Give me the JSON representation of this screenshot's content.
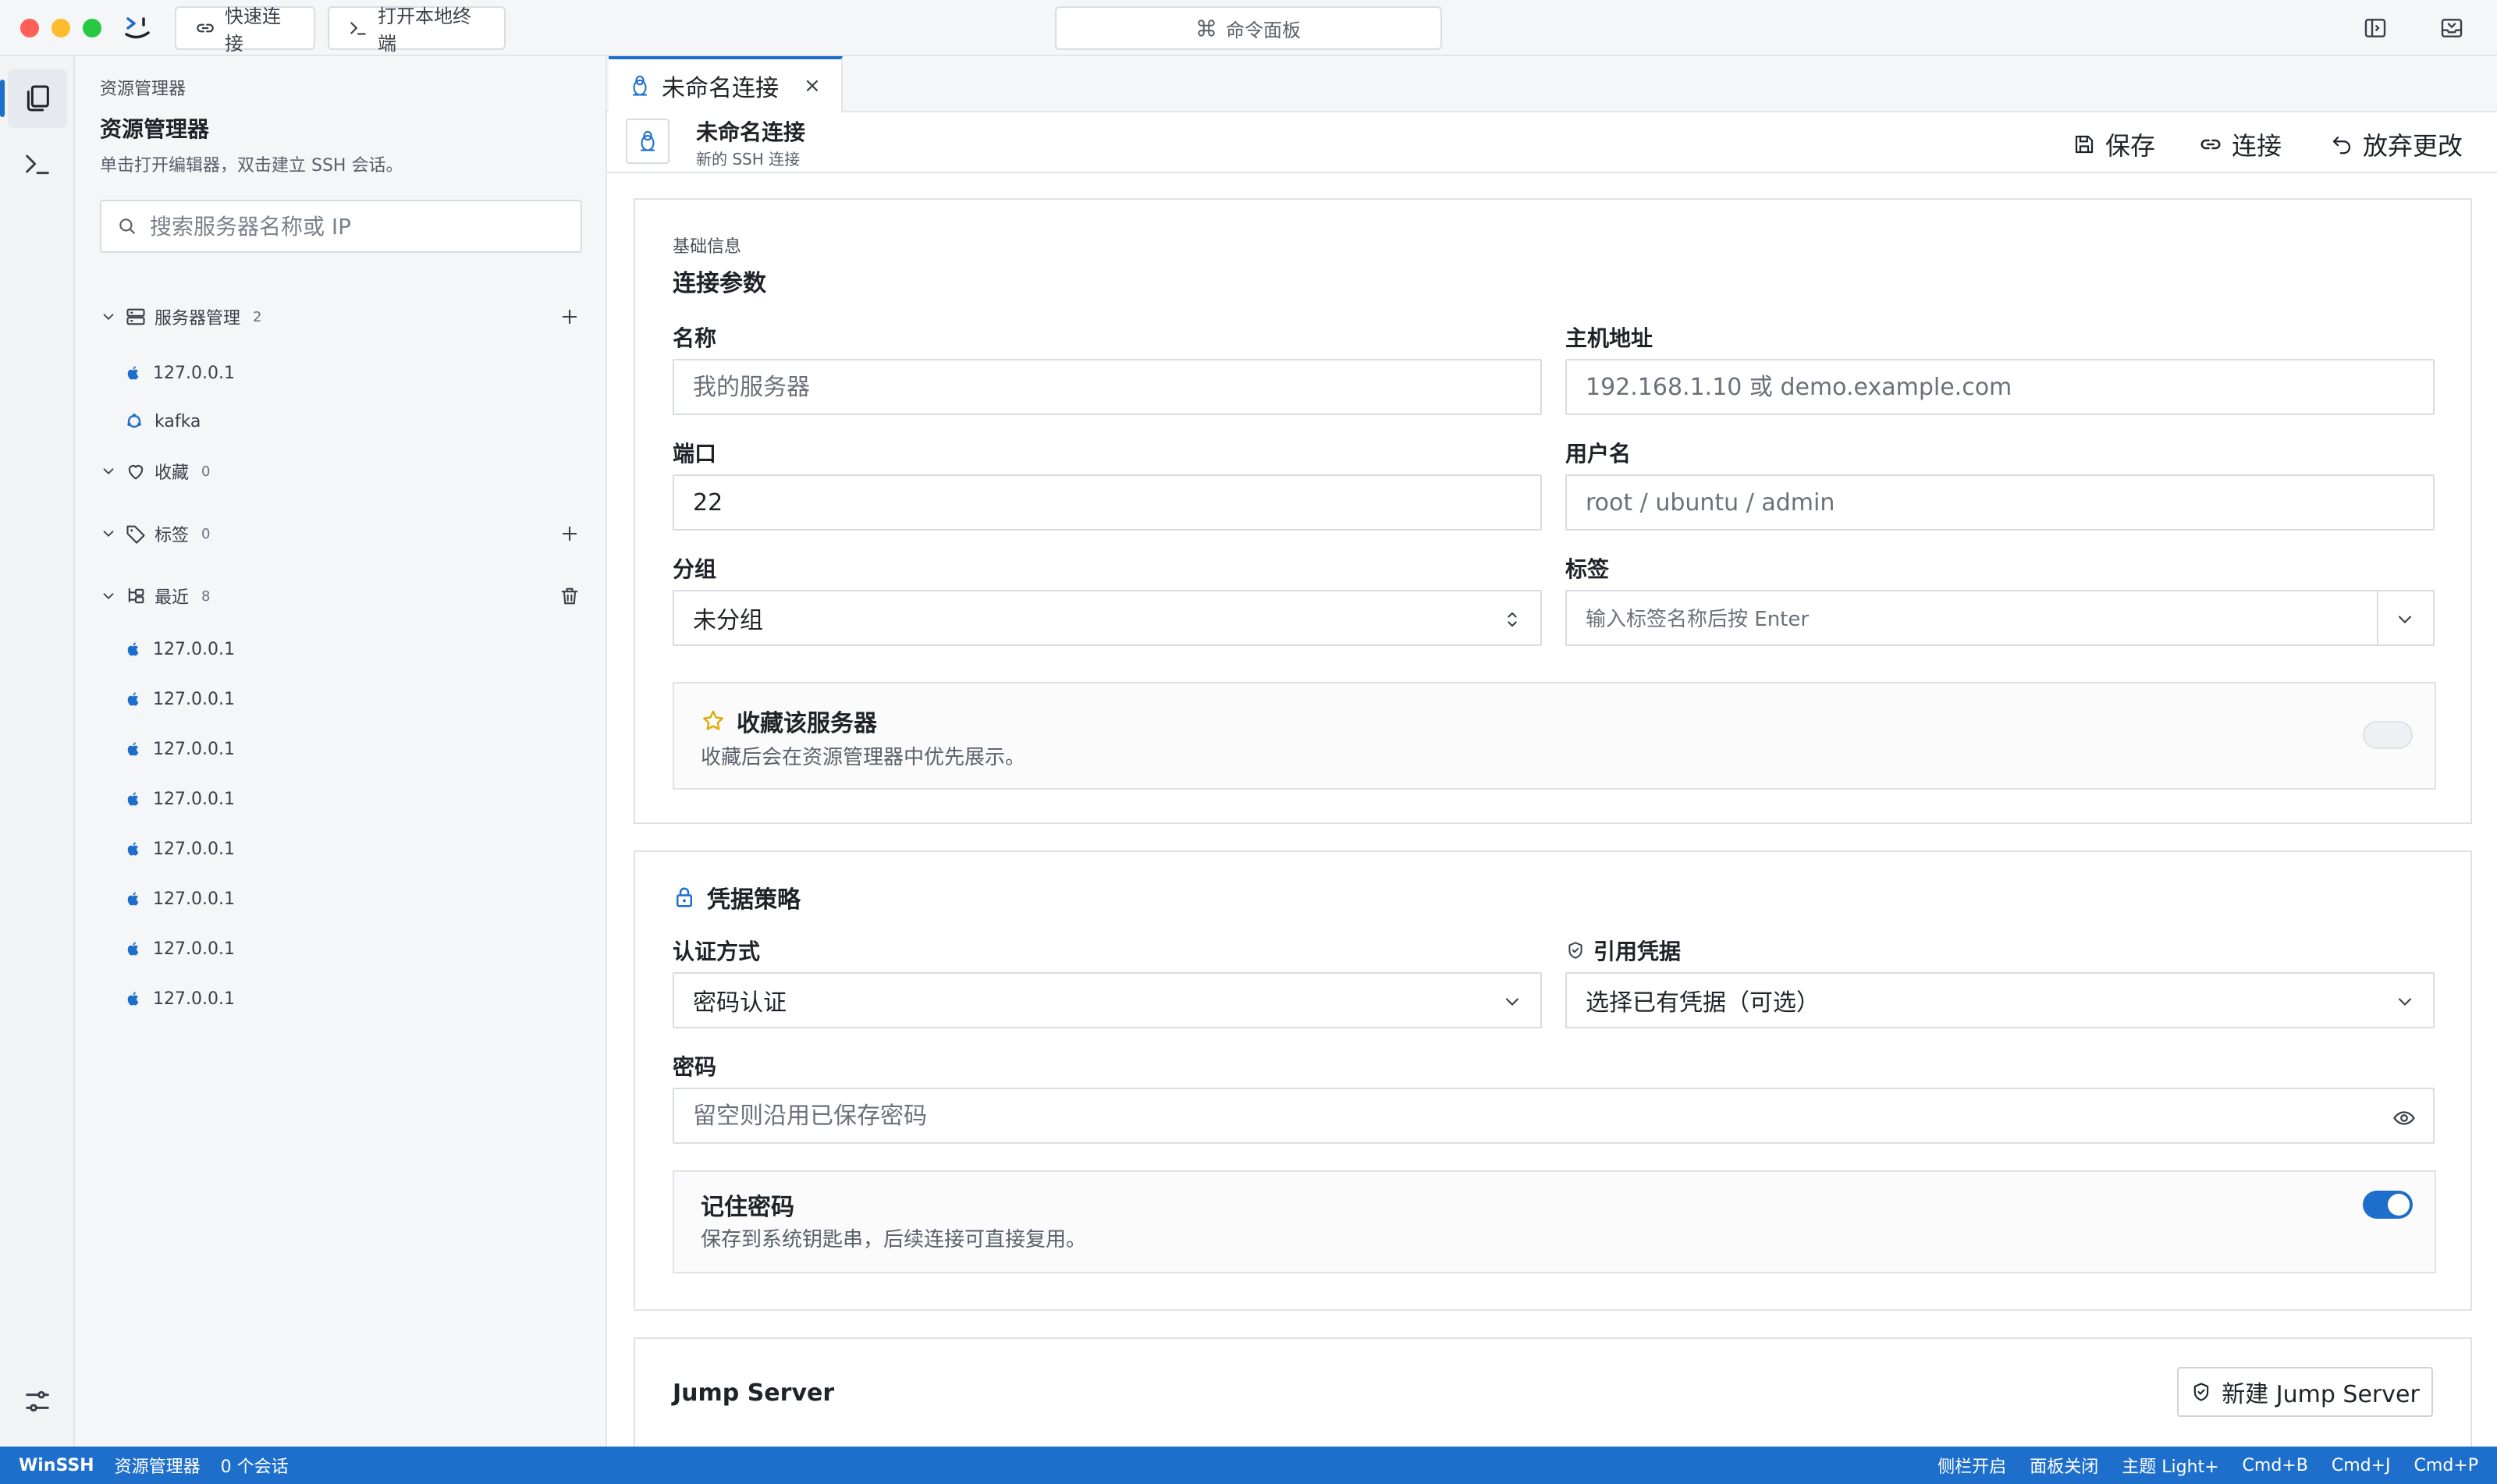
{
  "titlebar": {
    "quick_connect": "快速连接",
    "open_terminal": "打开本地终端",
    "command_palette": "命令面板"
  },
  "sidebar": {
    "kicker": "资源管理器",
    "title": "资源管理器",
    "subtitle": "单击打开编辑器，双击建立 SSH 会话。",
    "search_placeholder": "搜索服务器名称或 IP",
    "groups": {
      "servers": {
        "label": "服务器管理",
        "count": "2"
      },
      "favorites": {
        "label": "收藏",
        "count": "0"
      },
      "tags": {
        "label": "标签",
        "count": "0"
      },
      "recent": {
        "label": "最近",
        "count": "8"
      }
    },
    "servers": [
      {
        "name": "127.0.0.1",
        "os_icon": "apple-icon"
      },
      {
        "name": "kafka",
        "os_icon": "ubuntu-icon"
      }
    ],
    "recent": [
      "127.0.0.1",
      "127.0.0.1",
      "127.0.0.1",
      "127.0.0.1",
      "127.0.0.1",
      "127.0.0.1",
      "127.0.0.1",
      "127.0.0.1"
    ]
  },
  "tab": {
    "label": "未命名连接",
    "close": "×"
  },
  "header": {
    "title": "未命名连接",
    "subtitle": "新的 SSH 连接",
    "save": "保存",
    "connect": "连接",
    "discard": "放弃更改"
  },
  "basic": {
    "kicker": "基础信息",
    "title": "连接参数",
    "name_label": "名称",
    "name_placeholder": "我的服务器",
    "host_label": "主机地址",
    "host_placeholder": "192.168.1.10 或 demo.example.com",
    "port_label": "端口",
    "port_value": "22",
    "user_label": "用户名",
    "user_placeholder": "root / ubuntu / admin",
    "group_label": "分组",
    "group_value": "未分组",
    "tags_label": "标签",
    "tags_placeholder": "输入标签名称后按 Enter",
    "favorite_title": "收藏该服务器",
    "favorite_desc": "收藏后会在资源管理器中优先展示。"
  },
  "credentials": {
    "title": "凭据策略",
    "auth_label": "认证方式",
    "auth_value": "密码认证",
    "ref_label": "引用凭据",
    "ref_value": "选择已有凭据（可选）",
    "password_label": "密码",
    "password_placeholder": "留空则沿用已保存密码",
    "remember_title": "记住密码",
    "remember_desc": "保存到系统钥匙串，后续连接可直接复用。"
  },
  "jump": {
    "title": "Jump Server",
    "new_button": "新建 Jump Server"
  },
  "statusbar": {
    "brand": "WinSSH",
    "view": "资源管理器",
    "sessions": "0 个会话",
    "sidebar_state": "侧栏开启",
    "panel_state": "面板关闭",
    "theme": "主题 Light+",
    "shortcut_b": "Cmd+B",
    "shortcut_j": "Cmd+J",
    "shortcut_p": "Cmd+P"
  },
  "colors": {
    "accent": "#1e6fcc",
    "star": "#e0a800",
    "traffic_red": "#fe5f57",
    "traffic_yellow": "#febc2e",
    "traffic_green": "#28c840"
  }
}
